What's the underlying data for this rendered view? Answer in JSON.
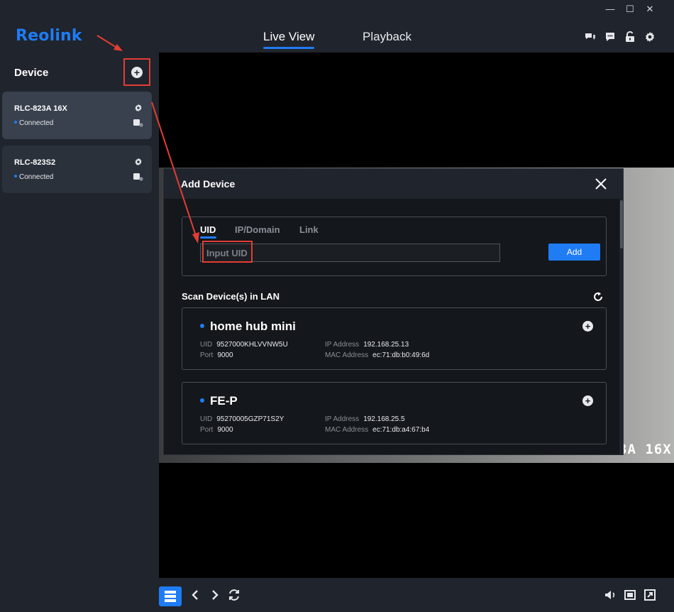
{
  "app": {
    "logo": "Reolink"
  },
  "window_controls": {
    "minimize": "—",
    "maximize": "☐",
    "close": "✕"
  },
  "header": {
    "tabs": [
      {
        "label": "Live View",
        "active": true
      },
      {
        "label": "Playback",
        "active": false
      }
    ],
    "icons": [
      "chat-icon",
      "message-icon",
      "unlock-icon",
      "gear-icon"
    ]
  },
  "sidebar": {
    "title": "Device",
    "devices": [
      {
        "name": "RLC-823A 16X",
        "status": "Connected",
        "selected": true
      },
      {
        "name": "RLC-823S2",
        "status": "Connected",
        "selected": false
      }
    ]
  },
  "video": {
    "stamp": "3A 16X"
  },
  "dialog": {
    "title": "Add Device",
    "tabs": [
      {
        "label": "UID",
        "active": true
      },
      {
        "label": "IP/Domain",
        "active": false
      },
      {
        "label": "Link",
        "active": false
      }
    ],
    "uid_input": {
      "value": "",
      "placeholder": "Input UID"
    },
    "add_label": "Add",
    "scan_title": "Scan Device(s) in LAN",
    "found_devices": [
      {
        "name": "home hub mini",
        "uid_label": "UID",
        "uid": "9527000KHLVVNW5U",
        "port_label": "Port",
        "port": "9000",
        "ip_label": "IP Address",
        "ip": "192.168.25.13",
        "mac_label": "MAC Address",
        "mac": "ec:71:db:b0:49:6d"
      },
      {
        "name": "FE-P",
        "uid_label": "UID",
        "uid": "95270005GZP71S2Y",
        "port_label": "Port",
        "port": "9000",
        "ip_label": "IP Address",
        "ip": "192.168.25.5",
        "mac_label": "MAC Address",
        "mac": "ec:71:db:a4:67:b4"
      }
    ]
  },
  "colors": {
    "accent": "#1f7cf5",
    "annotation": "#e23d35",
    "sidebar_bg": "#20242c",
    "dialog_bg": "#14171b"
  }
}
